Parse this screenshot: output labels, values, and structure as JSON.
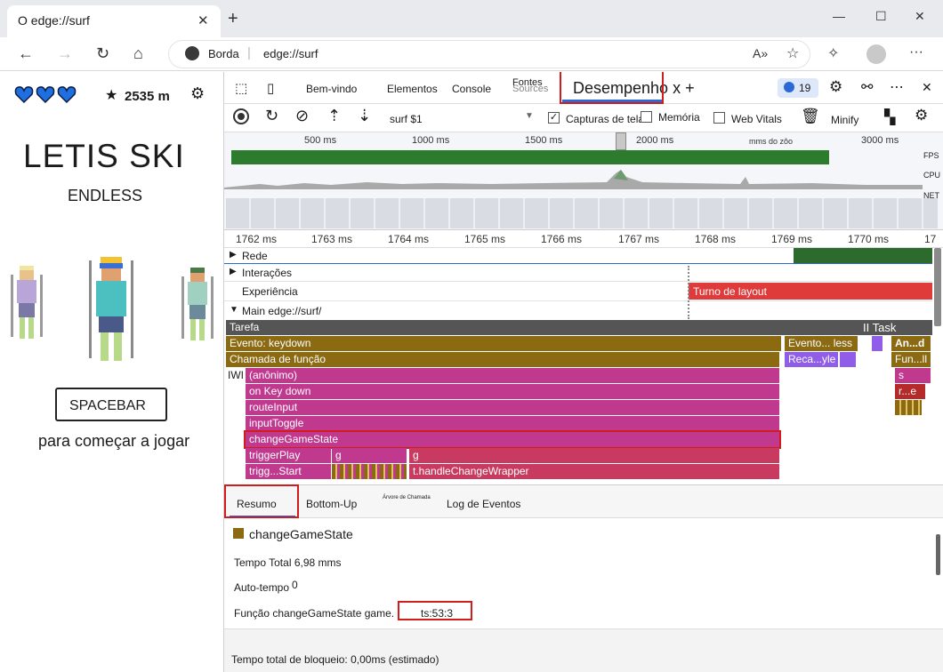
{
  "browser": {
    "tab_title": "O edge://surf",
    "address_site": "Borda",
    "address_url": "edge://surf"
  },
  "game": {
    "hearts": 3,
    "distance": "2535 m",
    "title": "LETIS SKI",
    "subtitle": "ENDLESS",
    "spacebar_label": "SPACEBAR",
    "start_prompt": "para começar a jogar"
  },
  "devtools": {
    "tabs": {
      "welcome": "Bem-vindo",
      "elements": "Elementos",
      "console": "Console",
      "sources_top": "Fontes",
      "sources_bottom": "Sources",
      "performance": "Desempenho x +",
      "issues_count": "19"
    },
    "toolbar": {
      "profile": "surf $1",
      "screenshots": "Capturas de tela",
      "memory": "Memória",
      "web_vitals": "Web Vitals",
      "minify": "Minify"
    },
    "overview": {
      "ticks": [
        "500 ms",
        "1000 ms",
        "1500 ms",
        "2000 ms",
        "mms do zôo",
        "3000 ms"
      ],
      "fps_label": "FPS",
      "cpu_label": "CPU",
      "net_label": "NET"
    },
    "ruler": [
      "1762 ms",
      "1763 ms",
      "1764 ms",
      "1765 ms",
      "1766 ms",
      "1767 ms",
      "1768 ms",
      "1769 ms",
      "1770 ms",
      "17"
    ],
    "tracks": {
      "network": "Rede",
      "interactions": "Interações",
      "experience": "Experiência",
      "layout_shift": "Turno de layout",
      "main": "Main edge://surf/"
    },
    "flame": {
      "task": "Tarefa",
      "task_right": "II Task",
      "event": "Evento: keydown",
      "event2": "Evento... less",
      "and": "An...d",
      "function_call": "Chamada de função",
      "recalc": "Reca...yle",
      "fun": "Fun...ll",
      "iwi": "IWI",
      "anon": "(anônimo)",
      "s": "s",
      "on_key_down": "on Key down",
      "re": "r...e",
      "route_input": "routeInput",
      "input_toggle": "inputToggle",
      "change_game_state": "changeGameState",
      "trigger_play": "triggerPlay",
      "g1": "g",
      "g2": "g",
      "trigg_start": "trigg...Start",
      "handle_change": "t.handleChangeWrapper"
    },
    "bottom_tabs": {
      "summary": "Resumo",
      "bottom_up": "Bottom-Up",
      "call_tree": "Árvore de Chamada",
      "event_log": "Log de Eventos"
    },
    "summary": {
      "name": "changeGameState",
      "total_time": "Tempo Total 6,98 mms",
      "self_time_label": "Auto-tempo",
      "self_time_value": "0",
      "function_prefix": "Função changeGameState game.",
      "function_link": "ts:53:3",
      "blocking": "Tempo total de bloqueio: 0,00ms (estimado)"
    },
    "colors": {
      "task": "#555555",
      "event": "#8b6a12",
      "function": "#c0398f",
      "layout_shift": "#e03b3b",
      "recalc": "#8f5de8",
      "handle": "#c83a5f"
    }
  }
}
